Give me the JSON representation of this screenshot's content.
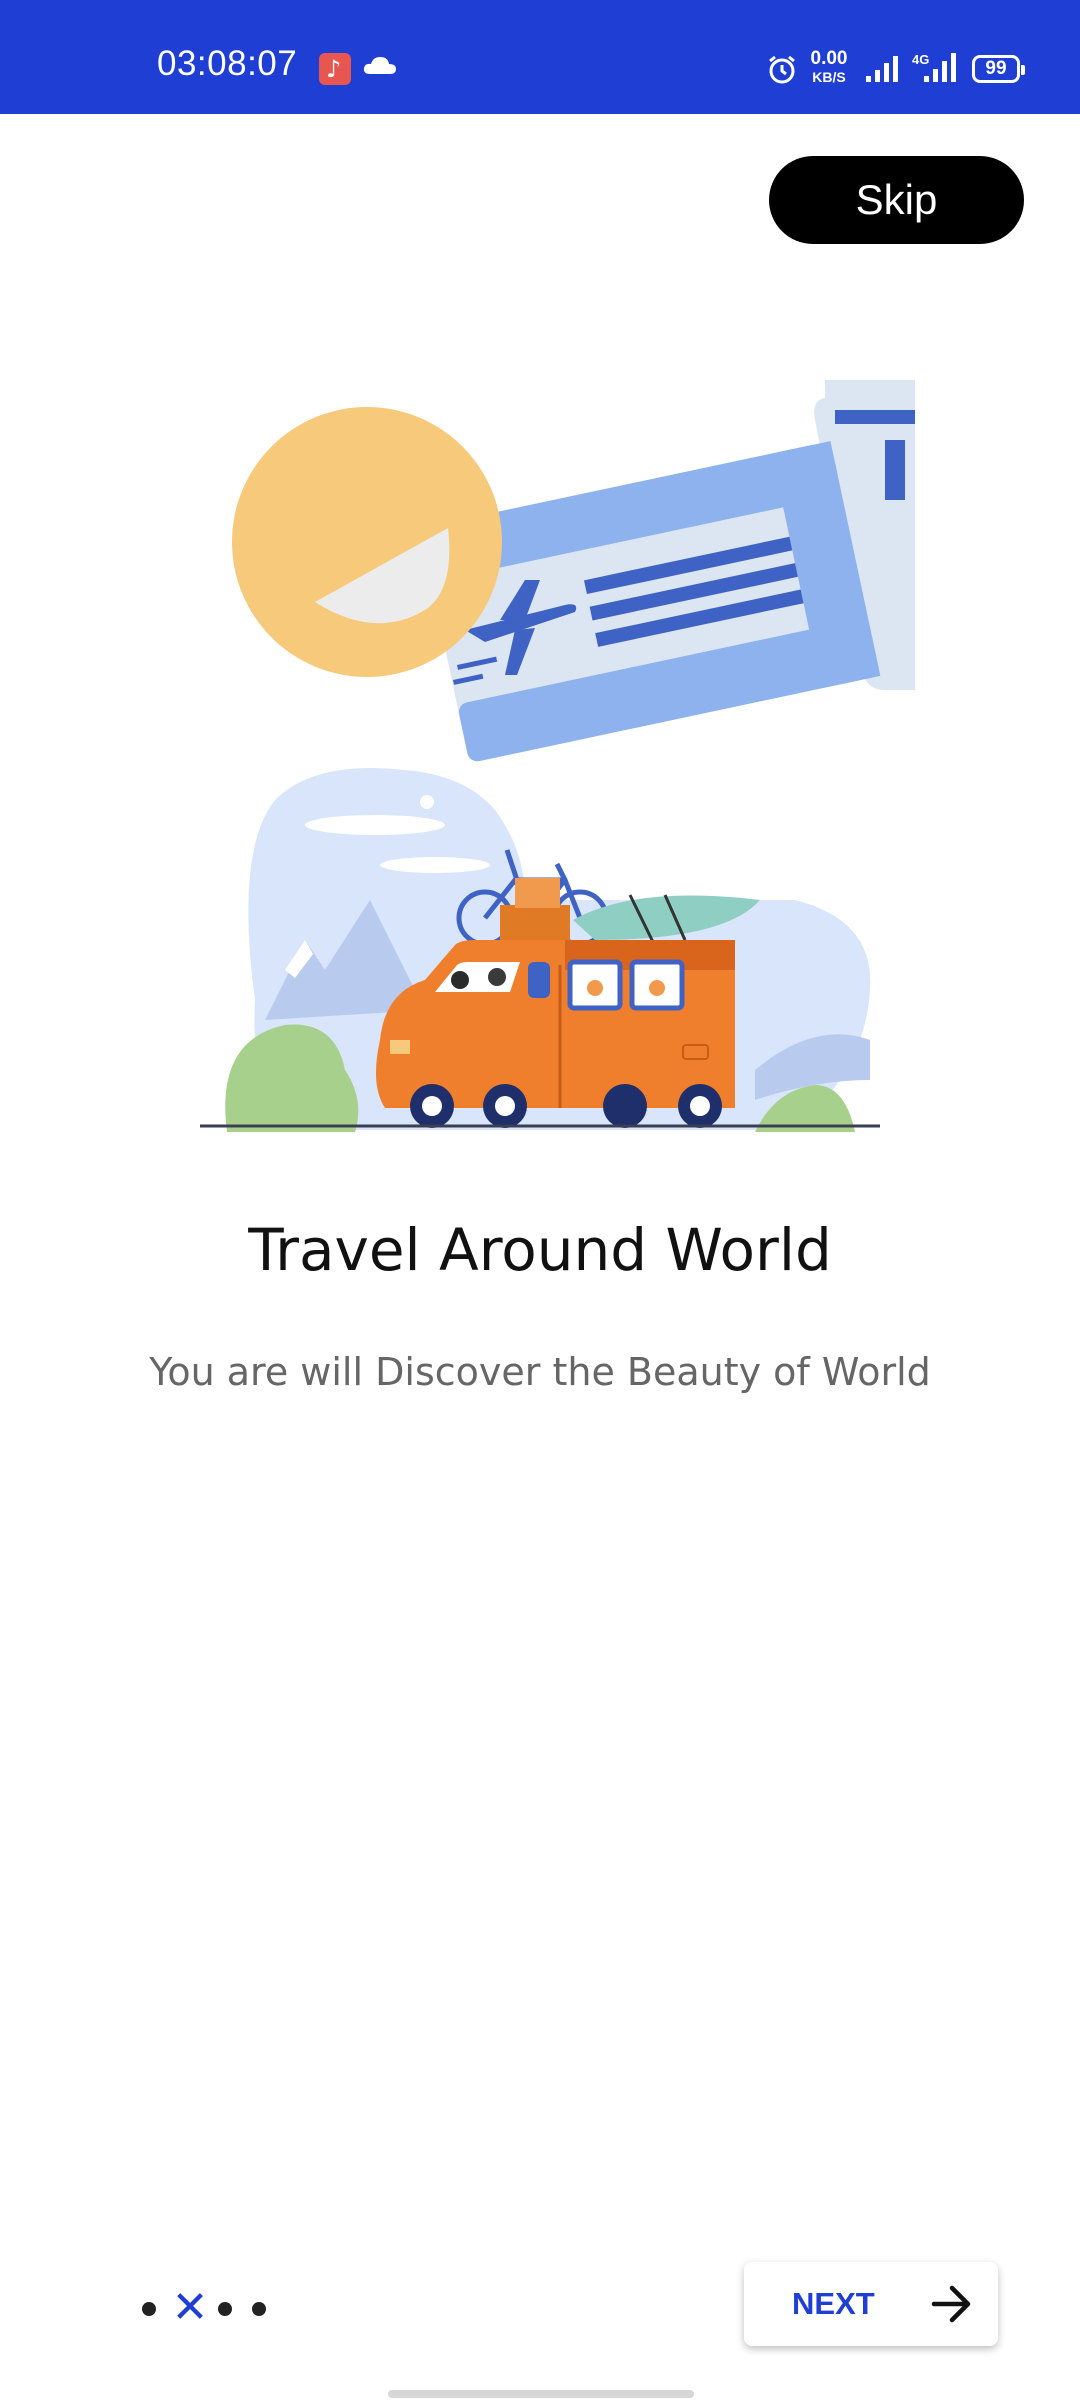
{
  "status_bar": {
    "time": "03:08:07",
    "net_speed": "0.00",
    "net_unit": "KB/S",
    "network_type": "4G",
    "battery": "99",
    "icons": [
      "music-app-icon",
      "cloud-icon",
      "alarm-icon",
      "signal-icon",
      "signal-4g-icon",
      "battery-icon"
    ],
    "background_color": "#1f3ed3"
  },
  "header": {
    "skip_label": "Skip"
  },
  "illustration": {
    "icon": "travel-illustration"
  },
  "content": {
    "title": "Travel Around World",
    "subtitle": "You are will Discover the Beauty of World"
  },
  "pager": {
    "current_page": 2,
    "total_pages": 4,
    "active_glyph": "✕"
  },
  "footer": {
    "next_label": "NEXT",
    "accent_color": "#1f3ed3"
  }
}
